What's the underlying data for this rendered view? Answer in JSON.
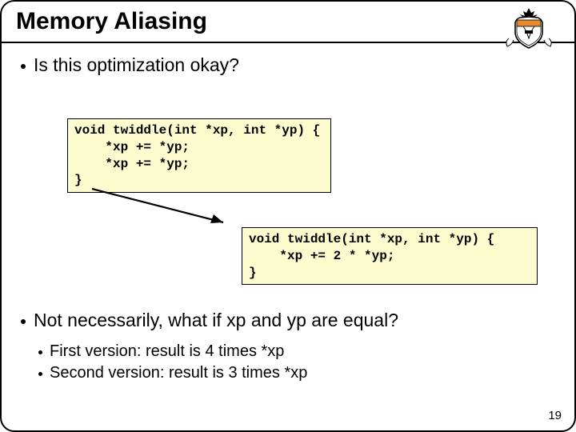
{
  "title": "Memory Aliasing",
  "q1": "Is this optimization okay?",
  "code1": "void twiddle(int *xp, int *yp) {\n    *xp += *yp;\n    *xp += *yp;\n}",
  "code2": "void twiddle(int *xp, int *yp) {\n    *xp += 2 * *yp;\n}",
  "ans": "Not necessarily, what if xp and yp are equal?",
  "sub1": "First version: result is 4 times *xp",
  "sub2": "Second version: result is 3 times *xp",
  "pagenum": "19"
}
